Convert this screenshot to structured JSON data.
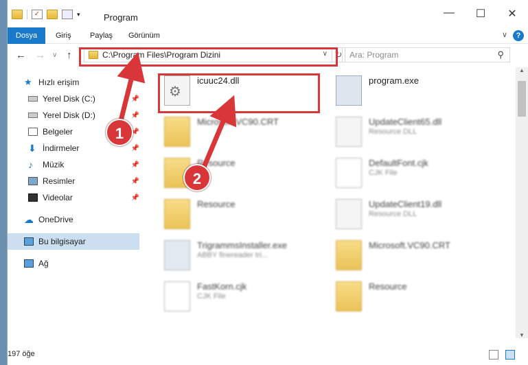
{
  "window": {
    "title": "Program",
    "minimize": "—",
    "maximize": "☐",
    "close": "✕"
  },
  "ribbon": {
    "tabs": [
      "Dosya",
      "Giriş",
      "Paylaş",
      "Görünüm"
    ],
    "help": "?",
    "collapse": "∨"
  },
  "nav": {
    "back": "←",
    "forward": "→",
    "recent": "∨",
    "up": "↑",
    "address": "C:\\Program Files\\Program Dizini",
    "address_dropdown": "∨",
    "refresh": "↻",
    "search_placeholder": "Ara: Program",
    "search_icon": "⚲"
  },
  "sidebar": {
    "items": [
      {
        "label": "Hızlı erişim",
        "icon": "star-icon",
        "pinned": false
      },
      {
        "label": "Yerel Disk (C:)",
        "icon": "drive-icon",
        "pinned": true
      },
      {
        "label": "Yerel Disk (D:)",
        "icon": "drive-icon",
        "pinned": true
      },
      {
        "label": "Belgeler",
        "icon": "documents-icon",
        "pinned": true
      },
      {
        "label": "İndirmeler",
        "icon": "download-icon",
        "pinned": true
      },
      {
        "label": "Müzik",
        "icon": "music-icon",
        "pinned": true
      },
      {
        "label": "Resimler",
        "icon": "pictures-icon",
        "pinned": true
      },
      {
        "label": "Videolar",
        "icon": "video-icon",
        "pinned": true
      },
      {
        "label": "OneDrive",
        "icon": "cloud-icon",
        "pinned": false
      },
      {
        "label": "Bu bilgisayar",
        "icon": "computer-icon",
        "pinned": false,
        "selected": true
      },
      {
        "label": "Ağ",
        "icon": "network-icon",
        "pinned": false
      }
    ],
    "pin_glyph": "📌"
  },
  "files": [
    {
      "name": "icuuc24.dll",
      "sub": "",
      "icon": "dll-gear-icon"
    },
    {
      "name": "program.exe",
      "sub": "",
      "icon": "exe-icon"
    },
    {
      "name": "Microsoft.VC90.CRT",
      "sub": "",
      "icon": "folder-icon"
    },
    {
      "name": "UpdateClient65.dll",
      "sub": "Resource DLL",
      "icon": "dll-gear-icon"
    },
    {
      "name": "Resource",
      "sub": "",
      "icon": "folder-icon"
    },
    {
      "name": "DefaultFont.cjk",
      "sub": "CJK File",
      "icon": "file-icon"
    },
    {
      "name": "Resource",
      "sub": "",
      "icon": "folder-icon"
    },
    {
      "name": "UpdateClient19.dll",
      "sub": "Resource DLL",
      "icon": "dll-gear-icon"
    },
    {
      "name": "TrigrammsInstaller.exe",
      "sub": "ABBY finereader tri...",
      "icon": "exe-icon"
    },
    {
      "name": "Microsoft.VC90.CRT",
      "sub": "",
      "icon": "folder-icon"
    },
    {
      "name": "FastKorn.cjk",
      "sub": "CJK File",
      "icon": "file-icon"
    },
    {
      "name": "Resource",
      "sub": "",
      "icon": "folder-icon"
    }
  ],
  "status": {
    "count": "197 öğe"
  },
  "markers": [
    "1",
    "2"
  ],
  "colors": {
    "accent": "#1979ca",
    "highlight": "#d9363a",
    "selected": "#ccdff0"
  }
}
